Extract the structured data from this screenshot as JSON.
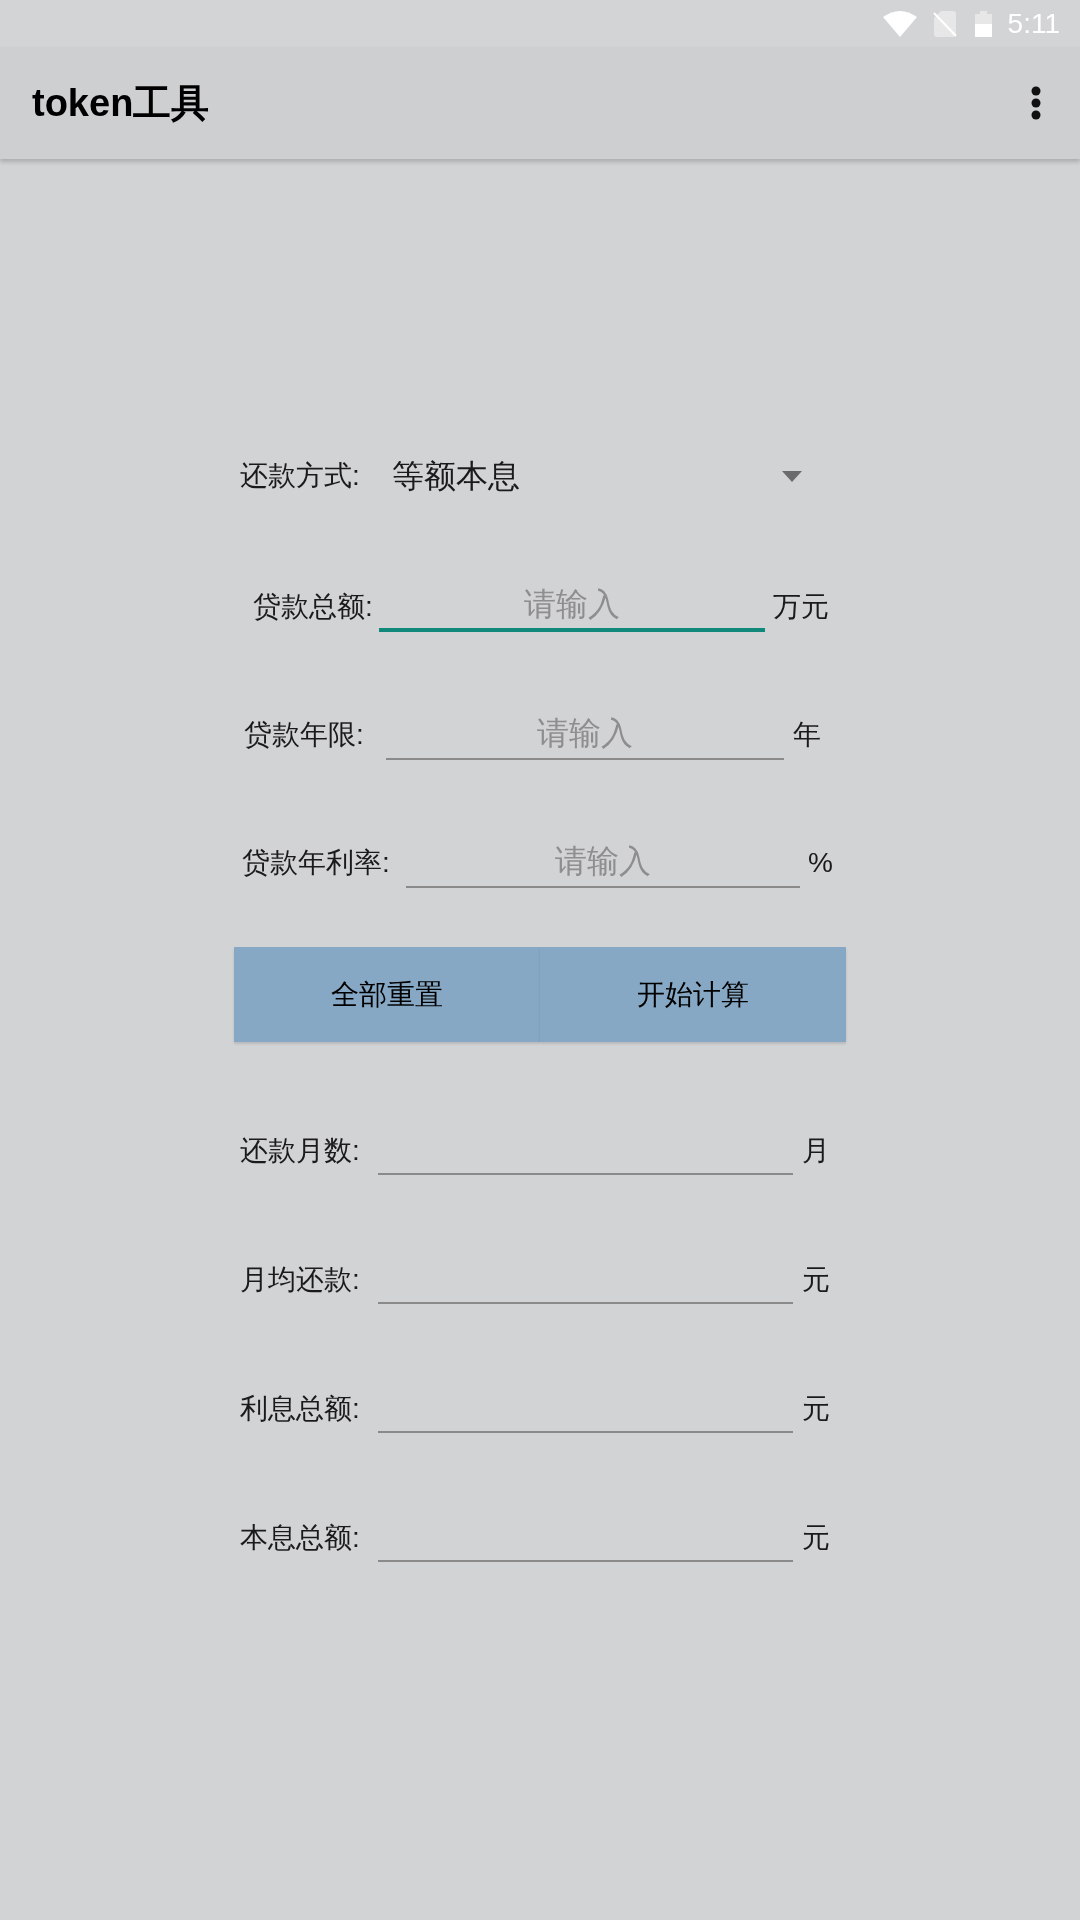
{
  "status_bar": {
    "time": "5:11"
  },
  "app_bar": {
    "title": "token工具"
  },
  "repayment_method": {
    "label": "还款方式:",
    "value": "等额本息"
  },
  "inputs": [
    {
      "label": "贷款总额:",
      "placeholder": "请输入",
      "unit": "万元",
      "focused": true
    },
    {
      "label": "贷款年限:",
      "placeholder": "请输入",
      "unit": "年",
      "focused": false
    },
    {
      "label": "贷款年利率:",
      "placeholder": "请输入",
      "unit": "%",
      "focused": false
    }
  ],
  "buttons": [
    {
      "label": "全部重置"
    },
    {
      "label": "开始计算"
    }
  ],
  "results": [
    {
      "label": "还款月数:",
      "unit": "月"
    },
    {
      "label": "月均还款:",
      "unit": "元"
    },
    {
      "label": "利息总额:",
      "unit": "元"
    },
    {
      "label": "本息总额:",
      "unit": "元"
    }
  ]
}
